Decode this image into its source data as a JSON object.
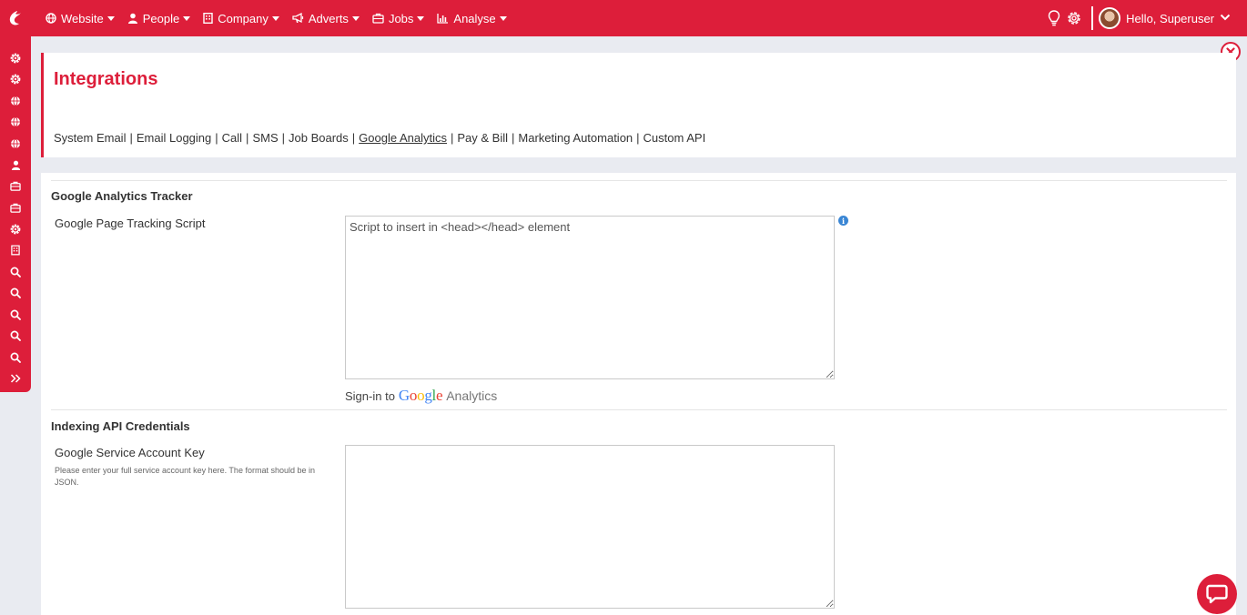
{
  "topnav": {
    "items": [
      {
        "label": "Website",
        "icon": "globe-icon"
      },
      {
        "label": "People",
        "icon": "person-icon"
      },
      {
        "label": "Company",
        "icon": "building-icon"
      },
      {
        "label": "Adverts",
        "icon": "megaphone-icon"
      },
      {
        "label": "Jobs",
        "icon": "briefcase-icon"
      },
      {
        "label": "Analyse",
        "icon": "chart-icon"
      }
    ],
    "greeting": "Hello, Superuser"
  },
  "sidebar": {
    "icons": [
      "gear-icon",
      "gear-icon",
      "globe-icon",
      "globe-icon",
      "globe-icon",
      "person-icon",
      "briefcase-icon",
      "briefcase-icon",
      "gear-icon",
      "building-icon",
      "search-icon",
      "search-icon",
      "search-icon",
      "search-icon",
      "search-icon",
      "double-chevron-right-icon"
    ]
  },
  "header": {
    "title": "Integrations",
    "tabs": [
      {
        "label": "System Email",
        "active": false
      },
      {
        "label": "Email Logging",
        "active": false
      },
      {
        "label": "Call",
        "active": false
      },
      {
        "label": "SMS",
        "active": false
      },
      {
        "label": "Job Boards",
        "active": false
      },
      {
        "label": "Google Analytics",
        "active": true
      },
      {
        "label": "Pay & Bill",
        "active": false
      },
      {
        "label": "Marketing Automation",
        "active": false
      },
      {
        "label": "Custom API",
        "active": false
      }
    ]
  },
  "tracker": {
    "section_title": "Google Analytics Tracker",
    "field_label": "Google Page Tracking Script",
    "placeholder": "Script to insert in <head></head> element",
    "value": "",
    "signin_prefix": "Sign-in to",
    "signin_brand": "Google",
    "signin_product": "Analytics"
  },
  "indexing": {
    "section_title": "Indexing API Credentials",
    "field_label": "Google Service Account Key",
    "help_text": "Please enter your full service account key here. The format should be in JSON.",
    "value": ""
  },
  "colors": {
    "brand": "#dd1e3a",
    "info": "#3a86d4"
  }
}
